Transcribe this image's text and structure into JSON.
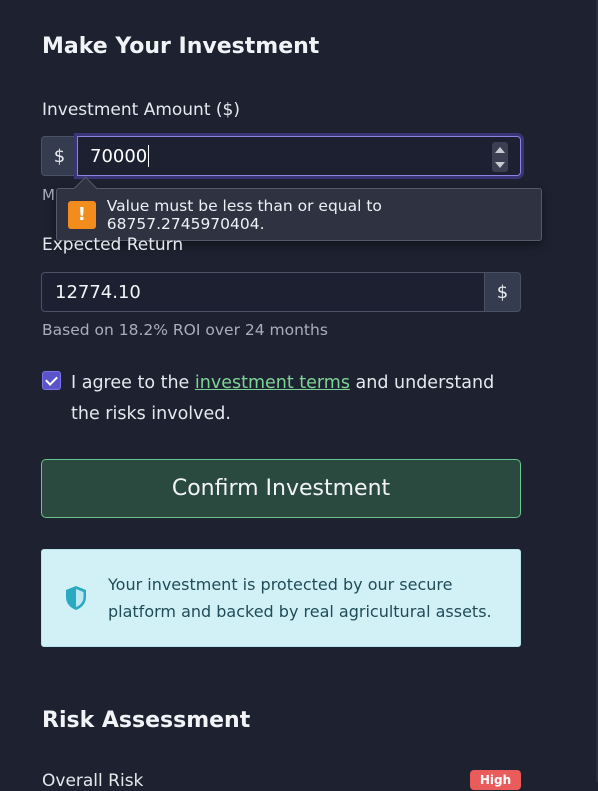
{
  "section": {
    "title": "Make Your Investment"
  },
  "amount": {
    "label": "Investment Amount ($)",
    "prefix": "$",
    "value": "70000",
    "hint_partial": "M"
  },
  "validation": {
    "message": "Value must be less than or equal to 68757.2745970404.",
    "icon": "!"
  },
  "expected_return": {
    "label": "Expected Return",
    "value": "12774.10",
    "suffix": "$",
    "helper": "Based on 18.2% ROI over 24 months"
  },
  "agreement": {
    "checked": true,
    "text_before": "I agree to the ",
    "link_text": "investment terms",
    "text_after": " and understand the risks involved."
  },
  "actions": {
    "confirm_label": "Confirm Investment"
  },
  "info": {
    "text": "Your investment is protected by our secure platform and backed by real agricultural assets."
  },
  "risk": {
    "title": "Risk Assessment",
    "overall_label": "Overall Risk",
    "badge": "High"
  },
  "colors": {
    "background": "#1e2230",
    "accent_purple": "#5a53c9",
    "accent_green": "#68c48a",
    "warning": "#f28c1c",
    "info_bg": "#d2f1f6",
    "danger": "#ea5b5b"
  }
}
